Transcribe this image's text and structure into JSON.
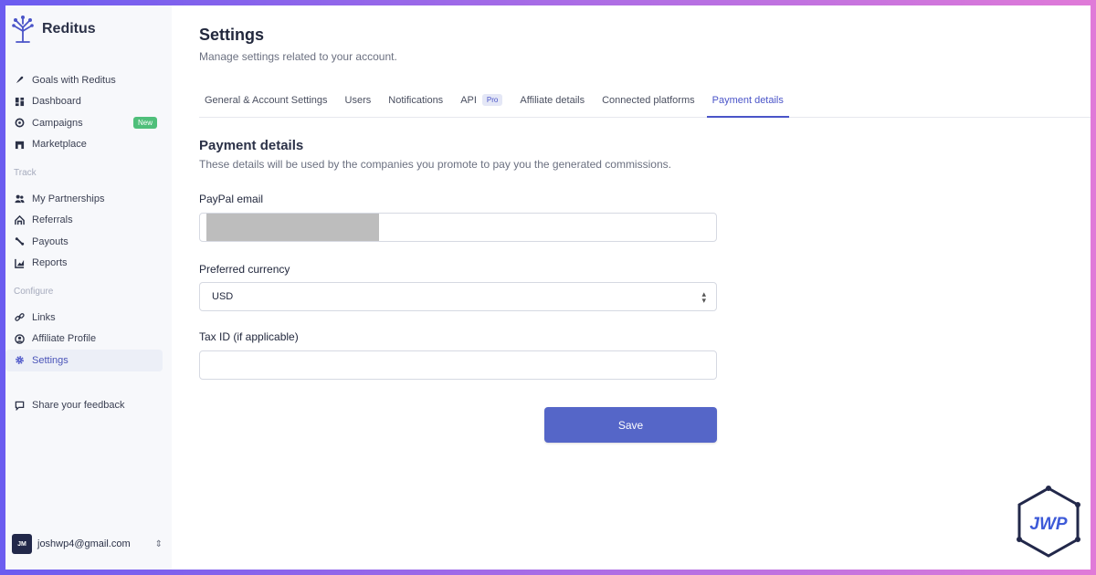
{
  "brand": {
    "name": "Reditus"
  },
  "nav": {
    "main": [
      {
        "label": "Goals with Reditus",
        "icon": "rocket-icon"
      },
      {
        "label": "Dashboard",
        "icon": "dashboard-icon"
      },
      {
        "label": "Campaigns",
        "icon": "campaign-icon",
        "badge": "New"
      },
      {
        "label": "Marketplace",
        "icon": "store-icon"
      }
    ],
    "track_label": "Track",
    "track": [
      {
        "label": "My Partnerships",
        "icon": "users-icon"
      },
      {
        "label": "Referrals",
        "icon": "referrals-icon"
      },
      {
        "label": "Payouts",
        "icon": "payouts-icon"
      },
      {
        "label": "Reports",
        "icon": "chart-icon"
      }
    ],
    "configure_label": "Configure",
    "configure": [
      {
        "label": "Links",
        "icon": "link-icon"
      },
      {
        "label": "Affiliate Profile",
        "icon": "profile-icon"
      },
      {
        "label": "Settings",
        "icon": "gear-icon",
        "active": true
      }
    ],
    "feedback": {
      "label": "Share your feedback",
      "icon": "feedback-icon"
    }
  },
  "user": {
    "initials": "JM",
    "email": "joshwp4@gmail.com"
  },
  "header": {
    "title": "Settings",
    "subtitle": "Manage settings related to your account."
  },
  "tabs": [
    {
      "label": "General & Account Settings"
    },
    {
      "label": "Users"
    },
    {
      "label": "Notifications"
    },
    {
      "label": "API",
      "badge": "Pro"
    },
    {
      "label": "Affiliate details"
    },
    {
      "label": "Connected platforms"
    },
    {
      "label": "Payment details",
      "active": true
    }
  ],
  "payment": {
    "title": "Payment details",
    "subtitle": "These details will be used by the companies you promote to pay you the generated commissions.",
    "paypal_label": "PayPal email",
    "paypal_value": "",
    "currency_label": "Preferred currency",
    "currency_value": "USD",
    "tax_label": "Tax ID (if applicable)",
    "tax_value": "",
    "save_label": "Save"
  },
  "watermark": {
    "text": "JWP"
  },
  "colors": {
    "accent": "#4a54c8",
    "button": "#5566c8",
    "new_badge": "#4fbf7a"
  }
}
